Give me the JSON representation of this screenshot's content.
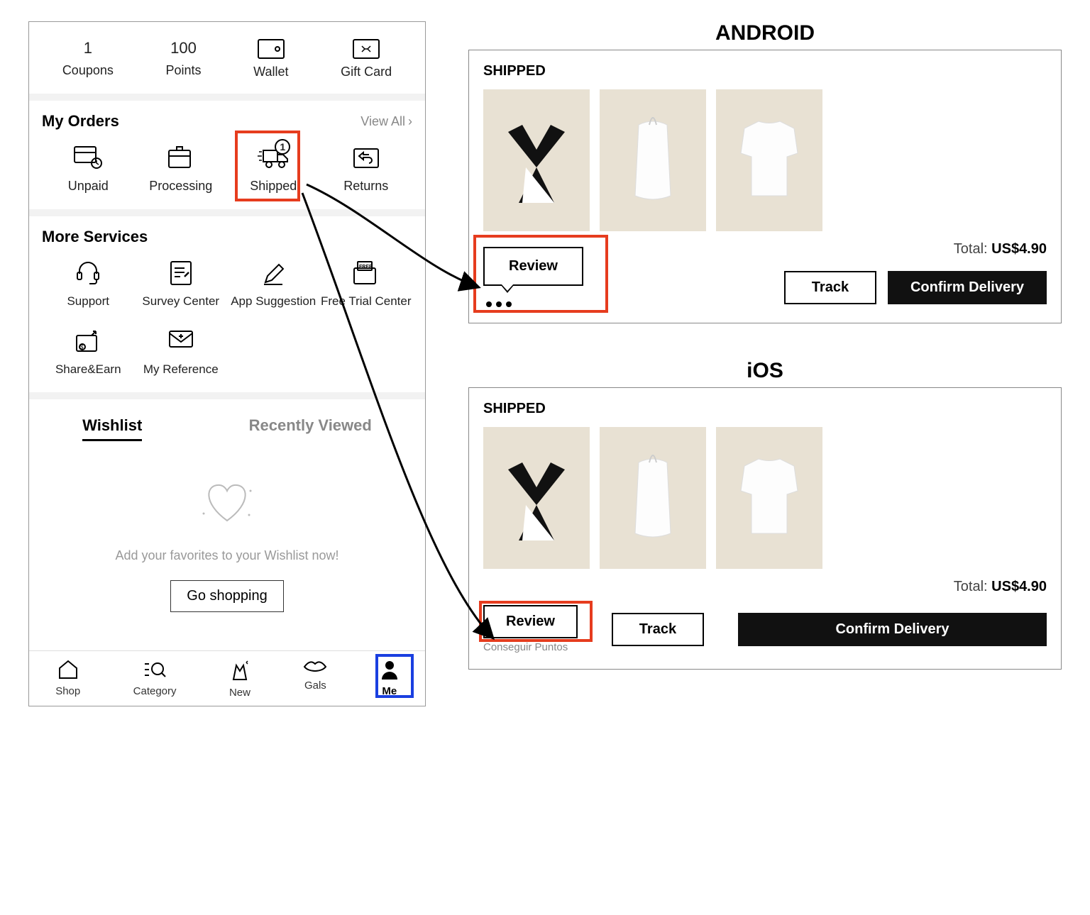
{
  "stats": {
    "coupons_count": "1",
    "coupons_label": "Coupons",
    "points_count": "100",
    "points_label": "Points",
    "wallet_label": "Wallet",
    "giftcard_label": "Gift Card"
  },
  "orders": {
    "title": "My Orders",
    "view_all": "View All",
    "unpaid": "Unpaid",
    "processing": "Processing",
    "shipped": "Shipped",
    "shipped_badge": "1",
    "returns": "Returns"
  },
  "services": {
    "title": "More Services",
    "items": [
      {
        "label": "Support"
      },
      {
        "label": "Survey Center"
      },
      {
        "label": "App Suggestion"
      },
      {
        "label": "Free Trial Center"
      },
      {
        "label": "Share&Earn"
      },
      {
        "label": "My Reference"
      }
    ]
  },
  "tabs": {
    "wishlist": "Wishlist",
    "recent": "Recently Viewed"
  },
  "wishlist": {
    "msg": "Add your favorites to your Wishlist now!",
    "button": "Go shopping"
  },
  "nav": {
    "shop": "Shop",
    "category": "Category",
    "new": "New",
    "gals": "Gals",
    "me": "Me"
  },
  "platform": {
    "android": "ANDROID",
    "ios": "iOS"
  },
  "card": {
    "status": "SHIPPED",
    "total_label": "Total: ",
    "total_value": "US$4.90",
    "review": "Review",
    "track": "Track",
    "confirm": "Confirm Delivery",
    "ios_sub": "Conseguir Puntos"
  }
}
